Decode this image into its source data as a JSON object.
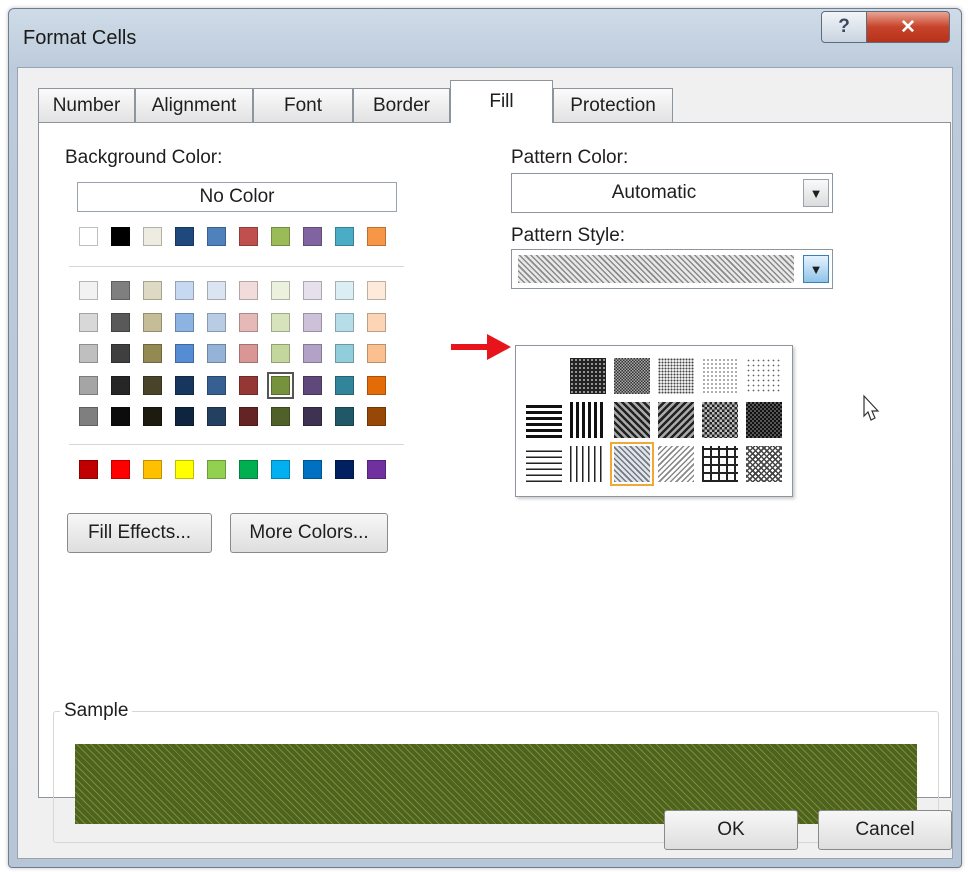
{
  "window": {
    "title": "Format Cells"
  },
  "tabs": [
    {
      "label": "Number"
    },
    {
      "label": "Alignment"
    },
    {
      "label": "Font"
    },
    {
      "label": "Border"
    },
    {
      "label": "Fill"
    },
    {
      "label": "Protection"
    }
  ],
  "active_tab": "Fill",
  "background_color": {
    "label": "Background Color:",
    "no_color_label": "No Color",
    "theme_row": [
      "#ffffff",
      "#000000",
      "#eeece1",
      "#1f497d",
      "#4f81bd",
      "#c0504d",
      "#9bbb59",
      "#8064a2",
      "#4bacc6",
      "#f79646"
    ],
    "tint_rows": [
      [
        "#f2f2f2",
        "#7f7f7f",
        "#ddd9c3",
        "#c6d9f0",
        "#dbe5f1",
        "#f2dcdb",
        "#ebf1dd",
        "#e5e0ec",
        "#dbeef3",
        "#fdeada"
      ],
      [
        "#d8d8d8",
        "#595959",
        "#c4bd97",
        "#8db3e2",
        "#b8cce4",
        "#e5b9b7",
        "#d7e3bc",
        "#ccc1d9",
        "#b7dde8",
        "#fbd5b5"
      ],
      [
        "#bfbfbf",
        "#3f3f3f",
        "#938953",
        "#548dd4",
        "#95b3d7",
        "#d99694",
        "#c3d69b",
        "#b2a2c7",
        "#92cddc",
        "#fac08f"
      ],
      [
        "#a5a5a5",
        "#262626",
        "#494429",
        "#17365d",
        "#366092",
        "#953734",
        "#76923c",
        "#5f497a",
        "#31859b",
        "#e36c09"
      ],
      [
        "#7f7f7f",
        "#0c0c0c",
        "#1d1b10",
        "#0f243e",
        "#244061",
        "#632423",
        "#4f6128",
        "#3f3151",
        "#205867",
        "#974806"
      ]
    ],
    "standard_row": [
      "#c00000",
      "#ff0000",
      "#ffc000",
      "#ffff00",
      "#92d050",
      "#00b050",
      "#00b0f0",
      "#0070c0",
      "#002060",
      "#7030a0"
    ],
    "selected_color": "#76923c"
  },
  "buttons": {
    "fill_effects": "Fill Effects...",
    "more_colors": "More Colors...",
    "ok": "OK",
    "cancel": "Cancel"
  },
  "pattern_color": {
    "label": "Pattern Color:",
    "value": "Automatic"
  },
  "pattern_style": {
    "label": "Pattern Style:",
    "selected_pattern": "thin-reverse-diagonal-stripe",
    "options": [
      "solid",
      "75-gray",
      "50-gray",
      "25-gray",
      "12.5-gray",
      "6.25-gray",
      "horizontal-stripe",
      "vertical-stripe",
      "reverse-diagonal-stripe",
      "diagonal-stripe",
      "diagonal-crosshatch",
      "thick-diagonal-crosshatch",
      "thin-horizontal-stripe",
      "thin-vertical-stripe",
      "thin-reverse-diagonal-stripe",
      "thin-diagonal-stripe",
      "thin-horizontal-crosshatch",
      "thin-diagonal-crosshatch"
    ]
  },
  "sample": {
    "label": "Sample",
    "fill_color": "#4f6128"
  },
  "colors": {
    "annotation_arrow": "#e8141c",
    "dropdown_highlight": "#f0a838"
  }
}
